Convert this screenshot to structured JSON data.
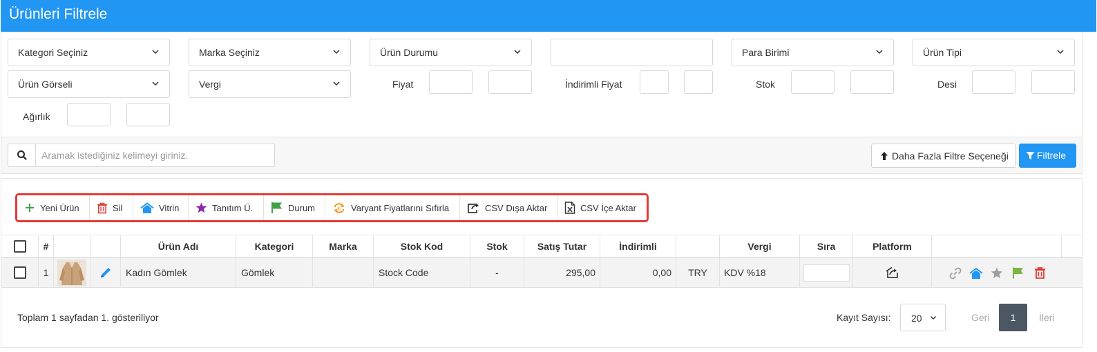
{
  "header": {
    "title": "Ürünleri Filtrele"
  },
  "filters": {
    "kategori": "Kategori Seçiniz",
    "marka": "Marka Seçiniz",
    "urun_durumu": "Ürün Durumu",
    "para_birimi": "Para Birimi",
    "urun_tipi": "Ürün Tipi",
    "urun_gorseli": "Ürün Görseli",
    "vergi": "Vergi",
    "fiyat_label": "Fiyat",
    "indirimli_fiyat_label": "İndirimli Fiyat",
    "stok_label": "Stok",
    "desi_label": "Desi",
    "agirlik_label": "Ağırlık"
  },
  "search": {
    "placeholder": "Aramak istediğiniz kelimeyi giriniz.",
    "more_filters_label": "Daha Fazla Filtre Seçeneği",
    "filter_button_label": "Filtrele"
  },
  "toolbar": {
    "new_product": "Yeni Ürün",
    "delete": "Sil",
    "showcase": "Vitrin",
    "promo": "Tanıtım Ü.",
    "status": "Durum",
    "reset_variant_prices": "Varyant Fiyatlarını Sıfırla",
    "csv_export": "CSV Dışa Aktar",
    "csv_import": "CSV İçe Aktar"
  },
  "table": {
    "headers": {
      "index": "#",
      "name": "Ürün Adı",
      "category": "Kategori",
      "brand": "Marka",
      "stock_code": "Stok Kod",
      "stock": "Stok",
      "price": "Satış Tutar",
      "discounted": "İndirimli",
      "tax": "Vergi",
      "order": "Sıra",
      "platform": "Platform"
    },
    "rows": [
      {
        "index": "1",
        "name": "Kadın Gömlek",
        "category": "Gömlek",
        "brand": "",
        "stock_code": "Stock Code",
        "stock": "-",
        "price": "295,00",
        "discounted": "0,00",
        "currency": "TRY",
        "tax": "KDV %18"
      }
    ]
  },
  "footer": {
    "summary": "Toplam 1 sayfadan 1. gösteriliyor",
    "page_size_label": "Kayıt Sayısı:",
    "page_size": "20",
    "prev": "Geri",
    "current_page": "1",
    "next": "İleri"
  },
  "colors": {
    "primary": "#2196f3",
    "toolbar_border": "#e53935",
    "danger": "#e53935",
    "success": "#43a047",
    "purple": "#8e24aa",
    "orange": "#fb8c00",
    "pager_active": "#4b5863"
  },
  "icons": {
    "search": "search-icon",
    "arrow_up": "arrow-up-icon",
    "filter": "filter-icon",
    "plus": "plus-icon",
    "trash": "trash-icon",
    "home": "home-icon",
    "star": "star-icon",
    "flag": "flag-icon",
    "refresh": "refresh-icon",
    "share": "share-icon",
    "excel": "excel-icon",
    "pencil": "pencil-icon",
    "link": "link-icon",
    "platform": "platform-icon"
  }
}
